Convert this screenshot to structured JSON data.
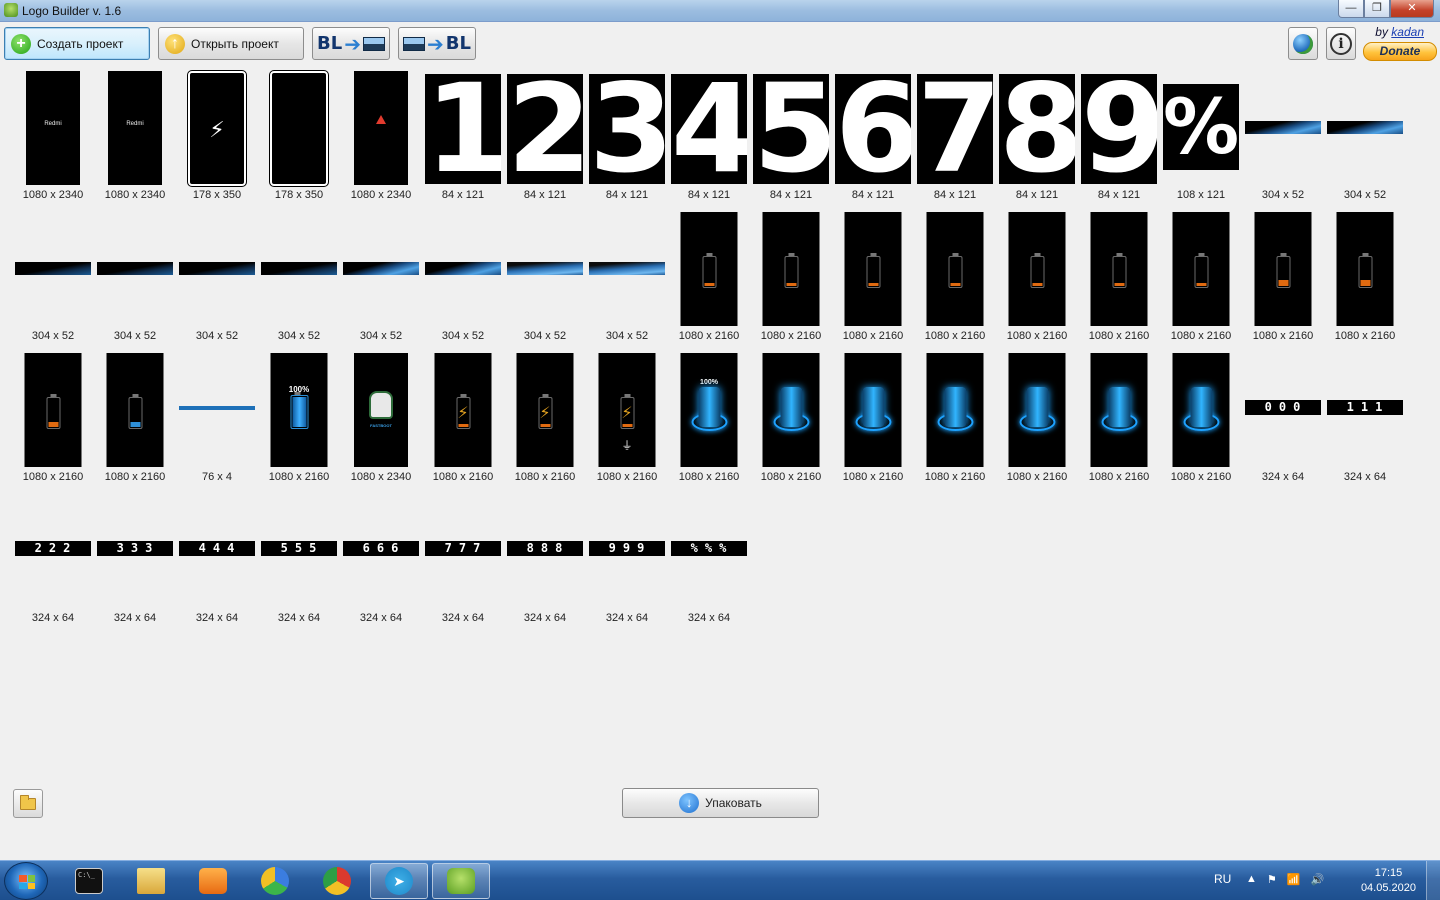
{
  "window": {
    "title": "Logo Builder v. 1.6",
    "min_glyph": "—",
    "max_glyph": "❐",
    "close_glyph": "✕"
  },
  "toolbar": {
    "create_label": "Создать проект",
    "open_label": "Открыть проект",
    "bl_label": "BL",
    "by_prefix": "by",
    "author": "kadan",
    "donate_label": "Donate"
  },
  "rows": [
    [
      {
        "kind": "phone",
        "size": "1080 x 2340",
        "text": "Redmi"
      },
      {
        "kind": "phone",
        "size": "1080 x 2340",
        "text": "Redmi"
      },
      {
        "kind": "outline-bolt",
        "size": "178 x 350"
      },
      {
        "kind": "outline",
        "size": "178 x 350"
      },
      {
        "kind": "phone-warn",
        "size": "1080 x 2340"
      },
      {
        "kind": "digit",
        "size": "84 x 121",
        "text": "1"
      },
      {
        "kind": "digit",
        "size": "84 x 121",
        "text": "2"
      },
      {
        "kind": "digit",
        "size": "84 x 121",
        "text": "3"
      },
      {
        "kind": "digit",
        "size": "84 x 121",
        "text": "4"
      },
      {
        "kind": "digit",
        "size": "84 x 121",
        "text": "5"
      },
      {
        "kind": "digit",
        "size": "84 x 121",
        "text": "6"
      },
      {
        "kind": "digit",
        "size": "84 x 121",
        "text": "7"
      },
      {
        "kind": "digit",
        "size": "84 x 121",
        "text": "8"
      },
      {
        "kind": "digit",
        "size": "84 x 121",
        "text": "9"
      },
      {
        "kind": "pct",
        "size": "108 x 121",
        "text": "%"
      },
      {
        "kind": "bar",
        "size": "304 x 52"
      },
      {
        "kind": "bar",
        "size": "304 x 52"
      }
    ],
    [
      {
        "kind": "bar-dark",
        "size": "304 x 52"
      },
      {
        "kind": "bar-dark",
        "size": "304 x 52"
      },
      {
        "kind": "bar-dark",
        "size": "304 x 52"
      },
      {
        "kind": "bar-dark",
        "size": "304 x 52"
      },
      {
        "kind": "bar",
        "size": "304 x 52"
      },
      {
        "kind": "bar",
        "size": "304 x 52"
      },
      {
        "kind": "bar-light",
        "size": "304 x 52"
      },
      {
        "kind": "bar-light",
        "size": "304 x 52"
      },
      {
        "kind": "batt",
        "size": "1080 x 2160",
        "level": 0.1
      },
      {
        "kind": "batt",
        "size": "1080 x 2160",
        "level": 0.1
      },
      {
        "kind": "batt",
        "size": "1080 x 2160",
        "level": 0.1
      },
      {
        "kind": "batt",
        "size": "1080 x 2160",
        "level": 0.1
      },
      {
        "kind": "batt",
        "size": "1080 x 2160",
        "level": 0.1
      },
      {
        "kind": "batt",
        "size": "1080 x 2160",
        "level": 0.1
      },
      {
        "kind": "batt",
        "size": "1080 x 2160",
        "level": 0.1
      },
      {
        "kind": "batt",
        "size": "1080 x 2160",
        "level": 0.2
      },
      {
        "kind": "batt",
        "size": "1080 x 2160",
        "level": 0.2
      }
    ],
    [
      {
        "kind": "batt",
        "size": "1080 x 2160",
        "level": 0.15
      },
      {
        "kind": "batt",
        "size": "1080 x 2160",
        "level": 0.15,
        "color": "#2e8fd8"
      },
      {
        "kind": "thin",
        "size": "76 x 4"
      },
      {
        "kind": "batt-full",
        "size": "1080 x 2160",
        "text": "100%"
      },
      {
        "kind": "mascot",
        "size": "1080 x 2340",
        "text": "FASTBOOT"
      },
      {
        "kind": "batt-bolt",
        "size": "1080 x 2160"
      },
      {
        "kind": "batt-bolt",
        "size": "1080 x 2160"
      },
      {
        "kind": "batt-plug",
        "size": "1080 x 2160"
      },
      {
        "kind": "glow-pct",
        "size": "1080 x 2160",
        "text": "100%"
      },
      {
        "kind": "glow",
        "size": "1080 x 2160"
      },
      {
        "kind": "glow",
        "size": "1080 x 2160"
      },
      {
        "kind": "glow",
        "size": "1080 x 2160"
      },
      {
        "kind": "glow",
        "size": "1080 x 2160"
      },
      {
        "kind": "glow",
        "size": "1080 x 2160"
      },
      {
        "kind": "glow",
        "size": "1080 x 2160"
      },
      {
        "kind": "strip",
        "size": "324 x 64",
        "text": "000"
      },
      {
        "kind": "strip",
        "size": "324 x 64",
        "text": "111"
      }
    ],
    [
      {
        "kind": "strip",
        "size": "324 x 64",
        "text": "222"
      },
      {
        "kind": "strip",
        "size": "324 x 64",
        "text": "333"
      },
      {
        "kind": "strip",
        "size": "324 x 64",
        "text": "444"
      },
      {
        "kind": "strip",
        "size": "324 x 64",
        "text": "555"
      },
      {
        "kind": "strip",
        "size": "324 x 64",
        "text": "666"
      },
      {
        "kind": "strip",
        "size": "324 x 64",
        "text": "777"
      },
      {
        "kind": "strip",
        "size": "324 x 64",
        "text": "888"
      },
      {
        "kind": "strip",
        "size": "324 x 64",
        "text": "999"
      },
      {
        "kind": "strip",
        "size": "324 x 64",
        "text": "%%%"
      }
    ]
  ],
  "footer": {
    "pack_label": "Упаковать",
    "pack_icon": "download-icon",
    "folder_icon": "folder-icon"
  },
  "taskbar": {
    "items": [
      "cmd",
      "explorer",
      "media-player",
      "chromium",
      "chrome",
      "telegram",
      "logo-builder"
    ],
    "active": "logo-builder",
    "cmd_text": "C:\\_",
    "telegram_glyph": "➤",
    "lang": "RU",
    "tray_glyphs": [
      "▲",
      "⚑",
      "📶",
      "🔊"
    ],
    "time": "17:15",
    "date": "04.05.2020"
  },
  "colors": {
    "accent": "#1e70b8",
    "batt_orange": "#e06a10",
    "glow_blue": "#1fa2ff"
  }
}
